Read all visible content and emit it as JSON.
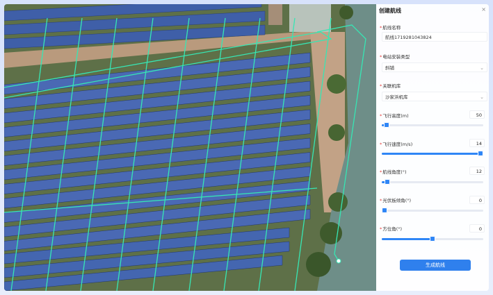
{
  "panel": {
    "title": "创建航线",
    "close_glyph": "×",
    "route_name": {
      "label": "航线名称",
      "value": "航线1719281043824"
    },
    "install_type": {
      "label": "电站安装类型",
      "value": "斜铺"
    },
    "hangar": {
      "label": "关联机库",
      "value": "沙家浜机库"
    },
    "altitude": {
      "label": "飞行高度(m)",
      "value": "50",
      "level": 0.02
    },
    "speed": {
      "label": "飞行速度(m/s)",
      "value": "14",
      "level": 1.0
    },
    "route_angle": {
      "label": "航线角度(°)",
      "value": "12",
      "level": 0.03
    },
    "panel_tilt": {
      "label": "光伏板倾角(°)",
      "value": "0",
      "level": 0.0
    },
    "azimuth": {
      "label": "方位角(°)",
      "value": "0",
      "level": 0.5
    },
    "generate_button": "生成航线"
  },
  "colors": {
    "accent": "#2f86f6",
    "route_line": "#37e6b4",
    "required": "#e53935"
  }
}
